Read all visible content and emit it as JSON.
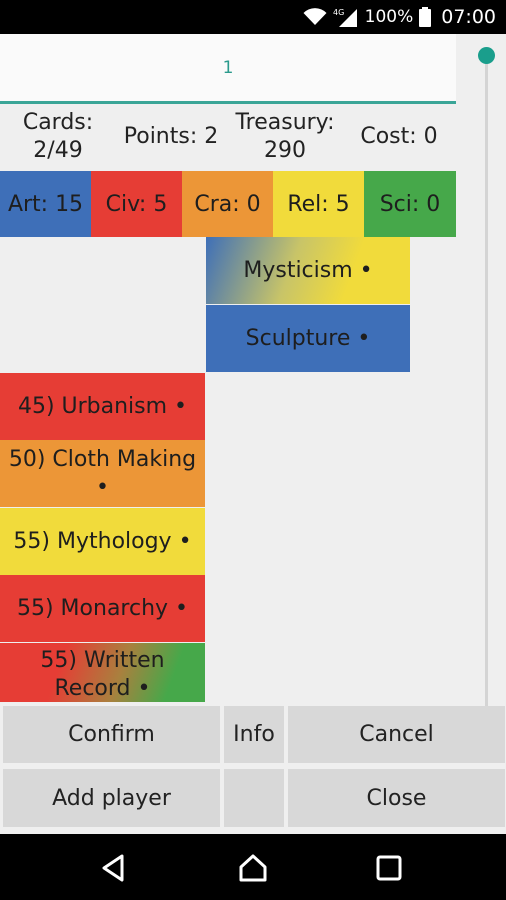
{
  "status_bar": {
    "battery": "100%",
    "time": "07:00",
    "network": "4G"
  },
  "tab": {
    "label": "1"
  },
  "stats": {
    "cards_label": "Cards:",
    "cards_value": "2/49",
    "points": "Points: 2",
    "treasury_label": "Treasury:",
    "treasury_value": "290",
    "cost": "Cost: 0"
  },
  "categories": [
    {
      "label": "Art: 15",
      "color": "#3e6fb8"
    },
    {
      "label": "Civ: 5",
      "color": "#e63d35"
    },
    {
      "label": "Cra: 0",
      "color": "#ec9637"
    },
    {
      "label": "Rel: 5",
      "color": "#f1db3b"
    },
    {
      "label": "Sci: 0",
      "color": "#46a84a"
    }
  ],
  "owned_cards": [
    {
      "label": "Mysticism •"
    },
    {
      "label": "Sculpture •"
    }
  ],
  "available_cards": [
    {
      "label": "45) Urbanism •"
    },
    {
      "label_line1": "50) Cloth Making",
      "label_line2": "•"
    },
    {
      "label": "55) Mythology •"
    },
    {
      "label": "55) Monarchy •"
    },
    {
      "label_line1": "55) Written",
      "label_line2": "Record •"
    }
  ],
  "buttons": {
    "confirm": "Confirm",
    "info": "Info",
    "cancel": "Cancel",
    "add_player": "Add player",
    "blank": "",
    "close": "Close"
  }
}
